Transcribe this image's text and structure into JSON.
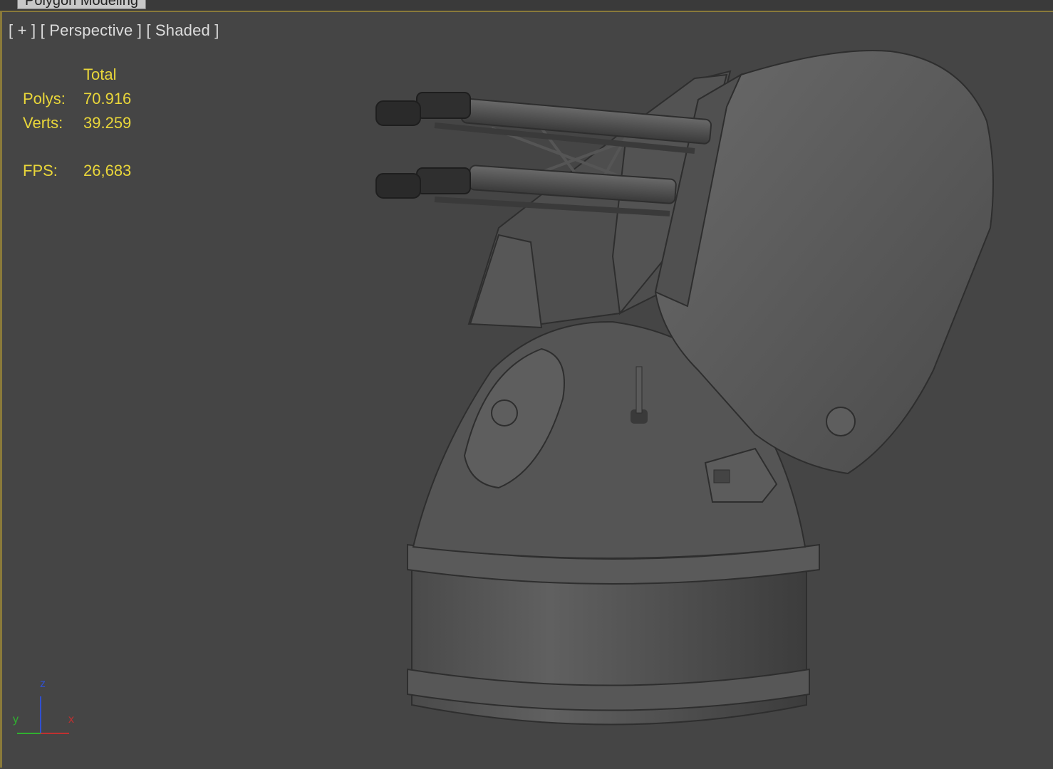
{
  "ribbon": {
    "tab_label": "Polygon Modeling"
  },
  "viewport": {
    "menu_plus": "[ + ]",
    "menu_view": "[ Perspective ]",
    "menu_shading": "[ Shaded ]"
  },
  "stats": {
    "header": "Total",
    "polys_label": "Polys:",
    "polys_value": "70.916",
    "verts_label": "Verts:",
    "verts_value": "39.259",
    "fps_label": "FPS:",
    "fps_value": "26,683"
  },
  "axis": {
    "x": "x",
    "y": "y",
    "z": "z"
  },
  "colors": {
    "viewport_bg": "#454545",
    "stats_text": "#e9d63a",
    "label_text": "#dcdcdc",
    "active_border": "#8a7a3a",
    "axis_x": "#c03030",
    "axis_y": "#30b030",
    "axis_z": "#3050d0"
  }
}
